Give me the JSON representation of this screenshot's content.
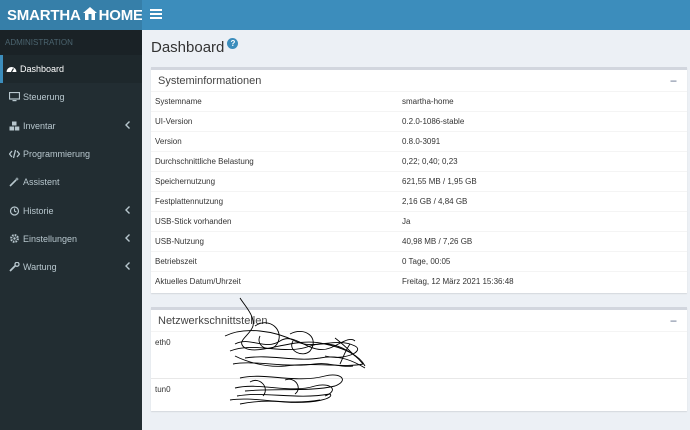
{
  "brand": {
    "left": "SMARTHA",
    "right": "HOME"
  },
  "sidebar": {
    "header": "ADMINISTRATION",
    "items": [
      {
        "label": "Dashboard",
        "icon": "dashboard-icon",
        "active": true,
        "has_children": false
      },
      {
        "label": "Steuerung",
        "icon": "monitor-icon",
        "active": false,
        "has_children": false
      },
      {
        "label": "Inventar",
        "icon": "cubes-icon",
        "active": false,
        "has_children": true
      },
      {
        "label": "Programmierung",
        "icon": "code-icon",
        "active": false,
        "has_children": false
      },
      {
        "label": "Assistent",
        "icon": "magic-wand-icon",
        "active": false,
        "has_children": false
      },
      {
        "label": "Historie",
        "icon": "history-icon",
        "active": false,
        "has_children": true
      },
      {
        "label": "Einstellungen",
        "icon": "gear-icon",
        "active": false,
        "has_children": true
      },
      {
        "label": "Wartung",
        "icon": "wrench-icon",
        "active": false,
        "has_children": true
      }
    ]
  },
  "page": {
    "title": "Dashboard",
    "help_symbol": "?"
  },
  "system_info": {
    "title": "Systeminformationen",
    "collapse_symbol": "−",
    "rows": [
      {
        "label": "Systemname",
        "value": "smartha-home"
      },
      {
        "label": "UI-Version",
        "value": "0.2.0-1086-stable"
      },
      {
        "label": "Version",
        "value": "0.8.0-3091"
      },
      {
        "label": "Durchschnittliche Belastung",
        "value": "0,22; 0,40; 0,23"
      },
      {
        "label": "Speichernutzung",
        "value": "621,55 MB / 1,95 GB"
      },
      {
        "label": "Festplattennutzung",
        "value": "2,16 GB / 4,84 GB"
      },
      {
        "label": "USB-Stick vorhanden",
        "value": "Ja"
      },
      {
        "label": "USB-Nutzung",
        "value": "40,98 MB / 7,26 GB"
      },
      {
        "label": "Betriebszeit",
        "value": "0 Tage, 00:05"
      },
      {
        "label": "Aktuelles Datum/Uhrzeit",
        "value": "Freitag, 12 März 2021 15:36:48"
      }
    ]
  },
  "network": {
    "title": "Netzwerkschnittstellen",
    "collapse_symbol": "−",
    "interfaces": [
      {
        "name": "eth0"
      },
      {
        "name": "tun0"
      }
    ]
  }
}
